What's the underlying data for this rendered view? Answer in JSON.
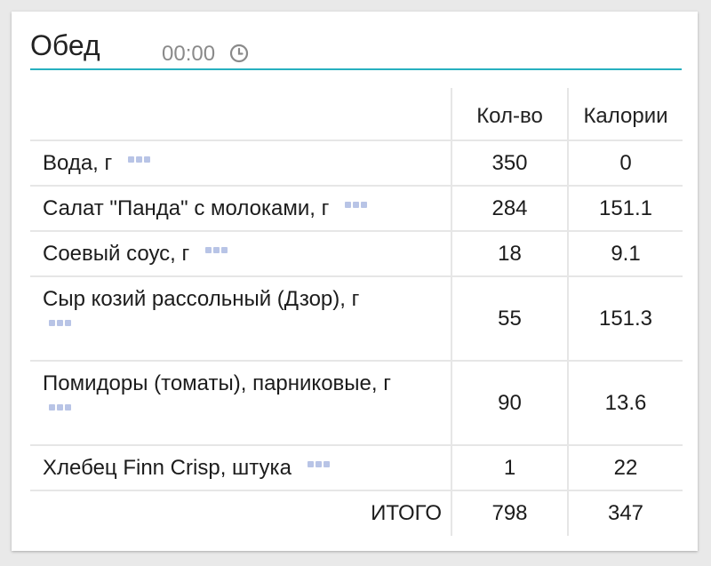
{
  "meal": {
    "title": "Обед",
    "time": "00:00"
  },
  "icons": {
    "clock": "clock-icon",
    "more": "more-dots-icon"
  },
  "colors": {
    "accent": "#27b0bf",
    "dots": "#b8c4e6"
  },
  "table": {
    "headers": {
      "quantity": "Кол-во",
      "calories": "Калории"
    },
    "rows": [
      {
        "name": "Вода, г",
        "qty": "350",
        "cal": "0"
      },
      {
        "name": "Салат \"Панда\" с молоками, г",
        "qty": "284",
        "cal": "151.1"
      },
      {
        "name": "Соевый соус, г",
        "qty": "18",
        "cal": "9.1"
      },
      {
        "name": "Сыр козий рассольный (Дзор), г",
        "qty": "55",
        "cal": "151.3"
      },
      {
        "name": "Помидоры (томаты), парниковые, г",
        "qty": "90",
        "cal": "13.6"
      },
      {
        "name": "Хлебец Finn Crisp, штука",
        "qty": "1",
        "cal": "22"
      }
    ],
    "total": {
      "label": "ИТОГО",
      "qty": "798",
      "cal": "347"
    }
  }
}
